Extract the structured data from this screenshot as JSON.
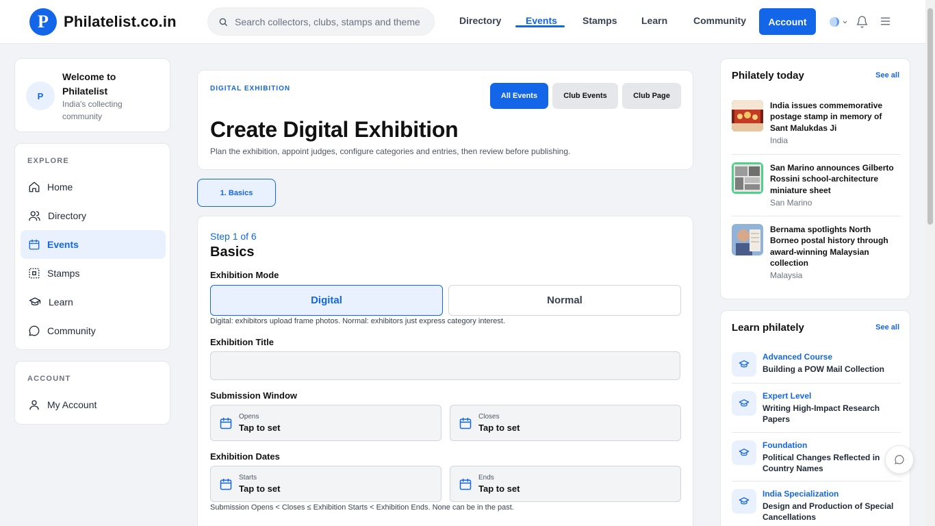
{
  "brand": {
    "logo_letter": "P",
    "name": "Philatelist.co.in"
  },
  "search": {
    "placeholder": "Search collectors, clubs, stamps and themes"
  },
  "nav": [
    "Directory",
    "Events",
    "Stamps",
    "Learn",
    "Community"
  ],
  "account_label": "Account",
  "colors": {
    "accent": "#1366e8",
    "accent_light": "#e8f1fd"
  },
  "welcome": {
    "avatar": "P",
    "title": "Welcome to Philatelist",
    "subtitle": "India's collecting community"
  },
  "explore": {
    "label": "EXPLORE",
    "items": [
      {
        "label": "Home",
        "icon": "home-icon"
      },
      {
        "label": "Directory",
        "icon": "users-icon"
      },
      {
        "label": "Events",
        "icon": "calendar-icon"
      },
      {
        "label": "Stamps",
        "icon": "stamp-icon"
      },
      {
        "label": "Learn",
        "icon": "graduation-cap-icon"
      },
      {
        "label": "Community",
        "icon": "chat-bubble-icon"
      }
    ]
  },
  "account": {
    "label": "ACCOUNT",
    "items": [
      {
        "label": "My Account",
        "icon": "user-icon"
      }
    ]
  },
  "hero": {
    "eyebrow": "DIGITAL EXHIBITION",
    "buttons": [
      "All Events",
      "Club Events",
      "Club Page"
    ],
    "title": "Create Digital Exhibition",
    "description": "Plan the exhibition, appoint judges, configure categories and entries, then review before publishing."
  },
  "step_tab": "1. Basics",
  "form": {
    "step_counter": "Step 1 of 6",
    "step_title": "Basics",
    "mode_label": "Exhibition Mode",
    "modes": [
      "Digital",
      "Normal"
    ],
    "mode_hint": "Digital: exhibitors upload frame photos. Normal: exhibitors just express category interest.",
    "title_label": "Exhibition Title",
    "title_value": "",
    "submission_label": "Submission Window",
    "opens_caption": "Opens",
    "closes_caption": "Closes",
    "dates_label": "Exhibition Dates",
    "starts_caption": "Starts",
    "ends_caption": "Ends",
    "tap_to_set": "Tap to set",
    "dates_hint": "Submission Opens < Closes ≤ Exhibition Starts < Exhibition Ends. None can be in the past."
  },
  "today": {
    "title": "Philately today",
    "see_all": "See all",
    "items": [
      {
        "title": "India issues commemorative postage stamp in memory of Sant Malukdas Ji",
        "country": "India"
      },
      {
        "title": "San Marino announces Gilberto Rossini school-architecture miniature sheet",
        "country": "San Marino"
      },
      {
        "title": "Bernama spotlights North Borneo postal history through award-winning Malaysian collection",
        "country": "Malaysia"
      }
    ]
  },
  "learn": {
    "title": "Learn philately",
    "see_all": "See all",
    "items": [
      {
        "level": "Advanced Course",
        "title": "Building a POW Mail Collection"
      },
      {
        "level": "Expert Level",
        "title": "Writing High-Impact Research Papers"
      },
      {
        "level": "Foundation",
        "title": "Political Changes Reflected in Country Names"
      },
      {
        "level": "India Specialization",
        "title": "Design and Production of Special Cancellations"
      }
    ]
  }
}
